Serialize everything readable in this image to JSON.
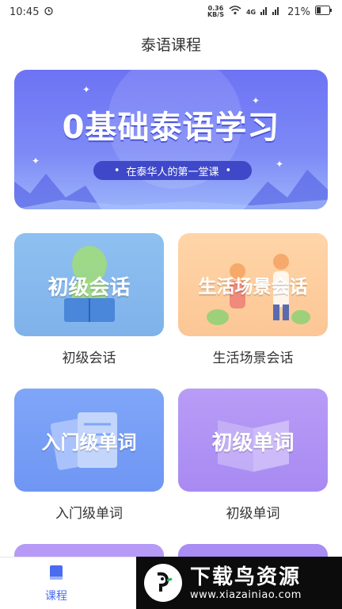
{
  "status_bar": {
    "time": "10:45",
    "net_speed_value": "0.36",
    "net_speed_unit": "KB/S",
    "signal_label": "4G",
    "battery": "21%"
  },
  "header": {
    "title": "泰语课程"
  },
  "banner": {
    "title": "0基础泰语学习",
    "subtitle": "在泰华人的第一堂课"
  },
  "courses": [
    {
      "card_text": "初级会话",
      "caption": "初级会话",
      "color": "#8ec0f1"
    },
    {
      "card_text": "生活场景会话",
      "caption": "生活场景会话",
      "color": "#ffd5a8"
    },
    {
      "card_text": "入门级单词",
      "caption": "入门级单词",
      "color": "#7fa6f8"
    },
    {
      "card_text": "初级单词",
      "caption": "初级单词",
      "color": "#b89cf6"
    }
  ],
  "tab_bar": {
    "items": [
      {
        "label": "课程",
        "icon": "book-icon",
        "active": true
      }
    ],
    "accent": "#4a6cf0"
  },
  "watermark": {
    "title": "下载鸟资源",
    "url": "www.xiazainiao.com"
  }
}
